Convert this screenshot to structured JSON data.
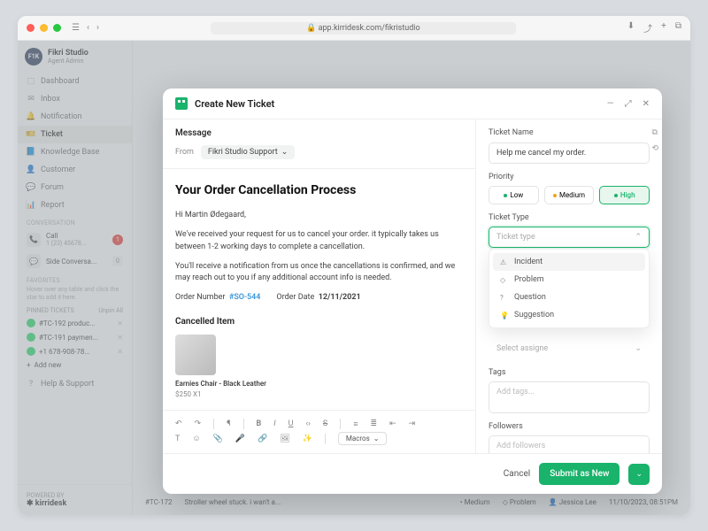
{
  "browser": {
    "url": "app.kirridesk.com/fikristudio"
  },
  "user": {
    "avatar_text": "F1K",
    "name": "Fikri Studio",
    "role": "Agent Admin"
  },
  "nav": [
    {
      "icon": "⬚",
      "label": "Dashboard"
    },
    {
      "icon": "✉",
      "label": "Inbox"
    },
    {
      "icon": "🔔",
      "label": "Notification"
    },
    {
      "icon": "🎫",
      "label": "Ticket",
      "active": true
    },
    {
      "icon": "📘",
      "label": "Knowledge Base"
    },
    {
      "icon": "👤",
      "label": "Customer"
    },
    {
      "icon": "💬",
      "label": "Forum"
    },
    {
      "icon": "📊",
      "label": "Report"
    }
  ],
  "conversation_label": "CONVERSATION",
  "conversations": [
    {
      "icon": "📞",
      "title": "Call",
      "sub": "1 (23) 45678...",
      "badge": 1,
      "badge_type": "red"
    },
    {
      "icon": "💬",
      "title": "Side Conversa...",
      "sub": "",
      "badge": 0,
      "badge_type": "gray"
    }
  ],
  "favorites": {
    "label": "FAVORITES",
    "hint": "Hover over any table and click the star to add it here."
  },
  "pinned": {
    "label": "PINNED TICKETS",
    "action": "Unpin All",
    "items": [
      {
        "label": "#TC-192 produc..."
      },
      {
        "label": "#TC-191 paymen..."
      },
      {
        "label": "+1 678-908-78..."
      },
      {
        "label": "Add new",
        "add": true
      }
    ]
  },
  "help": "Help & Support",
  "powered": "POWERED BY",
  "brand": "kirridesk",
  "table_row": {
    "id": "#TC-172",
    "title": "Stroller wheel stuck. i wan't a...",
    "priority": "Medium",
    "type": "Problem",
    "assignee": "Jessica Lee",
    "date": "11/10/2023, 08:51PM"
  },
  "modal": {
    "title": "Create New Ticket",
    "message_label": "Message",
    "from_label": "From",
    "from_value": "Fikri Studio Support",
    "heading": "Your Order Cancellation Process",
    "greeting": "Hi Martin Ødegaard,",
    "p1": "We've received your request for us to cancel your order. it typically takes us between 1-2 working days to complete a cancellation.",
    "p2": "You'll receive a notification from us once the cancellations is confirmed, and we may reach out to you if any additional account info is needed.",
    "order_number_label": "Order Number",
    "order_number": "#SO-544",
    "order_date_label": "Order Date",
    "order_date": "12/11/2021",
    "cancelled_label": "Cancelled Item",
    "item_name": "Earnies Chair - Black Leather",
    "item_price": "$250 X1",
    "macros": "Macros",
    "ticket_name_label": "Ticket Name",
    "ticket_name": "Help me cancel my order.",
    "priority_label": "Priority",
    "priorities": {
      "low": "Low",
      "medium": "Medium",
      "high": "High"
    },
    "ticket_type_label": "Ticket Type",
    "ticket_type_placeholder": "Ticket type",
    "type_options": [
      {
        "icon": "⚠",
        "label": "Incident",
        "selected": true
      },
      {
        "icon": "◇",
        "label": "Problem"
      },
      {
        "icon": "?",
        "label": "Question"
      },
      {
        "icon": "💡",
        "label": "Suggestion"
      }
    ],
    "assignee_placeholder": "Select assigne",
    "tags_label": "Tags",
    "tags_placeholder": "Add tags...",
    "followers_label": "Followers",
    "followers_placeholder": "Add followers",
    "cancel": "Cancel",
    "submit": "Submit as New"
  }
}
